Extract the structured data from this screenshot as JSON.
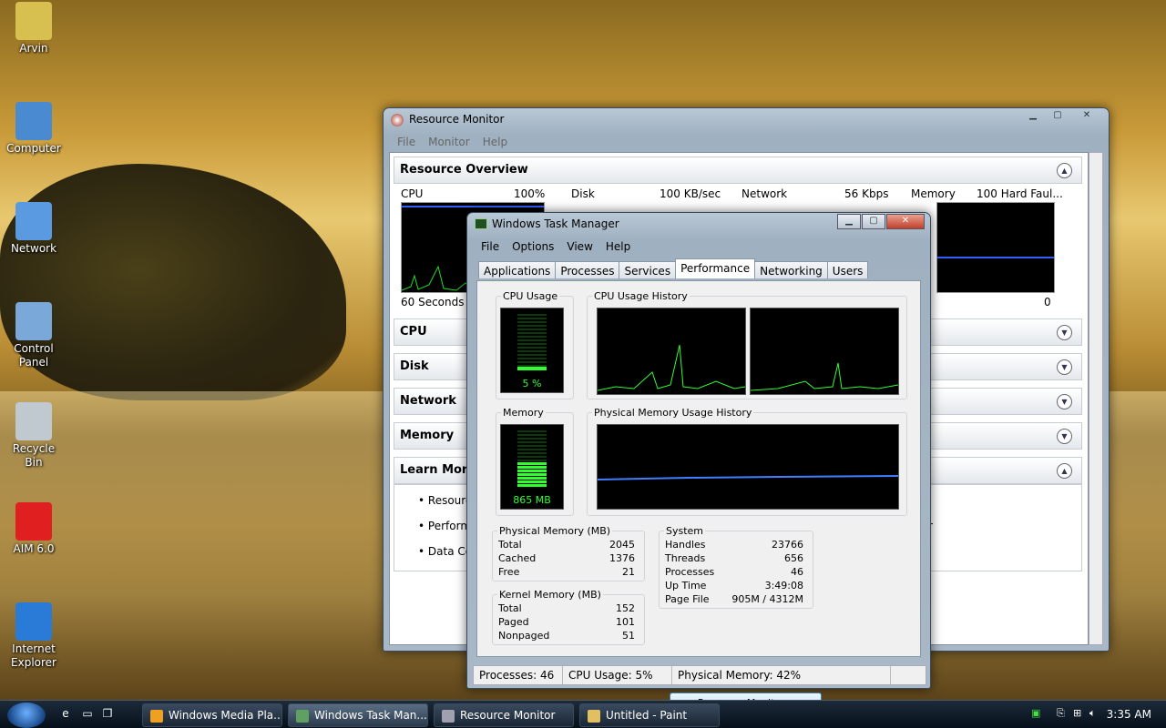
{
  "desktop": {
    "icons": [
      {
        "label": "Arvin",
        "name": "user-folder-icon",
        "color": "#d8c050"
      },
      {
        "label": "Computer",
        "name": "computer-icon",
        "color": "#4a8ad0"
      },
      {
        "label": "Network",
        "name": "network-icon",
        "color": "#5a9ae0"
      },
      {
        "label": "Control Panel",
        "name": "control-panel-icon",
        "color": "#7aa8d8"
      },
      {
        "label": "Recycle Bin",
        "name": "recycle-bin-icon",
        "color": "#c0c8d0"
      },
      {
        "label": "AIM 6.0",
        "name": "aim-icon",
        "color": "#e02020"
      },
      {
        "label": "Internet Explorer",
        "name": "internet-explorer-icon",
        "color": "#2a7ad8"
      }
    ]
  },
  "resource_monitor": {
    "title": "Resource Monitor",
    "menu": [
      "File",
      "Monitor",
      "Help"
    ],
    "overview": {
      "label": "Resource Overview",
      "graphs": [
        {
          "name": "CPU",
          "scale": "100%",
          "footer": "60 Seconds"
        },
        {
          "name": "Disk",
          "scale": "100 KB/sec"
        },
        {
          "name": "Network",
          "scale": "56 Kbps"
        },
        {
          "name": "Memory",
          "scale": "100 Hard Faul...",
          "footer_right": "0"
        }
      ]
    },
    "sections": [
      "CPU",
      "Disk",
      "Network",
      "Memory",
      "Learn More"
    ],
    "learn_more": [
      "Resourc",
      "Performa",
      "Data Co"
    ],
    "learn_more_tail": "r"
  },
  "task_manager": {
    "title": "Windows Task Manager",
    "menu": [
      "File",
      "Options",
      "View",
      "Help"
    ],
    "tabs": [
      "Applications",
      "Processes",
      "Services",
      "Performance",
      "Networking",
      "Users"
    ],
    "active_tab": "Performance",
    "cpu_usage_label": "CPU Usage",
    "cpu_usage_value": "5 %",
    "cpu_history_label": "CPU Usage History",
    "memory_label": "Memory",
    "memory_value": "865 MB",
    "mem_history_label": "Physical Memory Usage History",
    "physical_memory": {
      "label": "Physical Memory (MB)",
      "rows": [
        [
          "Total",
          "2045"
        ],
        [
          "Cached",
          "1376"
        ],
        [
          "Free",
          "21"
        ]
      ]
    },
    "kernel_memory": {
      "label": "Kernel Memory (MB)",
      "rows": [
        [
          "Total",
          "152"
        ],
        [
          "Paged",
          "101"
        ],
        [
          "Nonpaged",
          "51"
        ]
      ]
    },
    "system": {
      "label": "System",
      "rows": [
        [
          "Handles",
          "23766"
        ],
        [
          "Threads",
          "656"
        ],
        [
          "Processes",
          "46"
        ],
        [
          "Up Time",
          "3:49:08"
        ],
        [
          "Page File",
          "905M / 4312M"
        ]
      ]
    },
    "resource_monitor_button": "Resource Monitor...",
    "status": {
      "processes": "Processes: 46",
      "cpu": "CPU Usage: 5%",
      "memory": "Physical Memory: 42%"
    }
  },
  "taskbar": {
    "buttons": [
      {
        "label": "Windows Media Pla...",
        "name": "taskbar-media-player",
        "color": "#f0a020"
      },
      {
        "label": "Windows Task Man...",
        "name": "taskbar-task-manager",
        "color": "#60a060"
      },
      {
        "label": "Resource Monitor",
        "name": "taskbar-resource-monitor",
        "color": "#a0a0b0"
      },
      {
        "label": "Untitled - Paint",
        "name": "taskbar-paint",
        "color": "#e0c060"
      }
    ],
    "clock": "3:35 AM"
  }
}
